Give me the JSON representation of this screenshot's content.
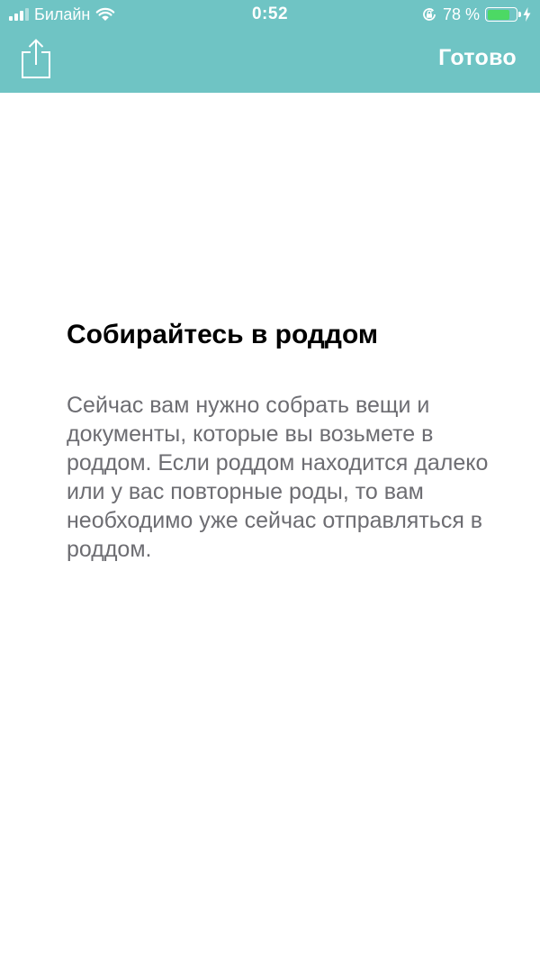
{
  "status_bar": {
    "carrier": "Билайн",
    "time": "0:52",
    "battery_percent": "78 %",
    "battery_level": 0.78,
    "icons": [
      "signal-icon",
      "wifi-icon",
      "orientation-lock-icon",
      "battery-icon",
      "charging-icon"
    ]
  },
  "nav": {
    "share_icon": "share-icon",
    "done_label": "Готово"
  },
  "content": {
    "title": "Собирайтесь в роддом",
    "body": "Сейчас вам нужно собрать вещи и документы, которые вы возьмете в роддом. Если роддом находится далеко или у вас повторные роды, то вам необходимо уже сейчас отправляться в роддом."
  },
  "colors": {
    "header_bg": "#6fc4c4",
    "title": "#000000",
    "body_text": "#6d6d72",
    "battery_fill": "#4cd964"
  }
}
